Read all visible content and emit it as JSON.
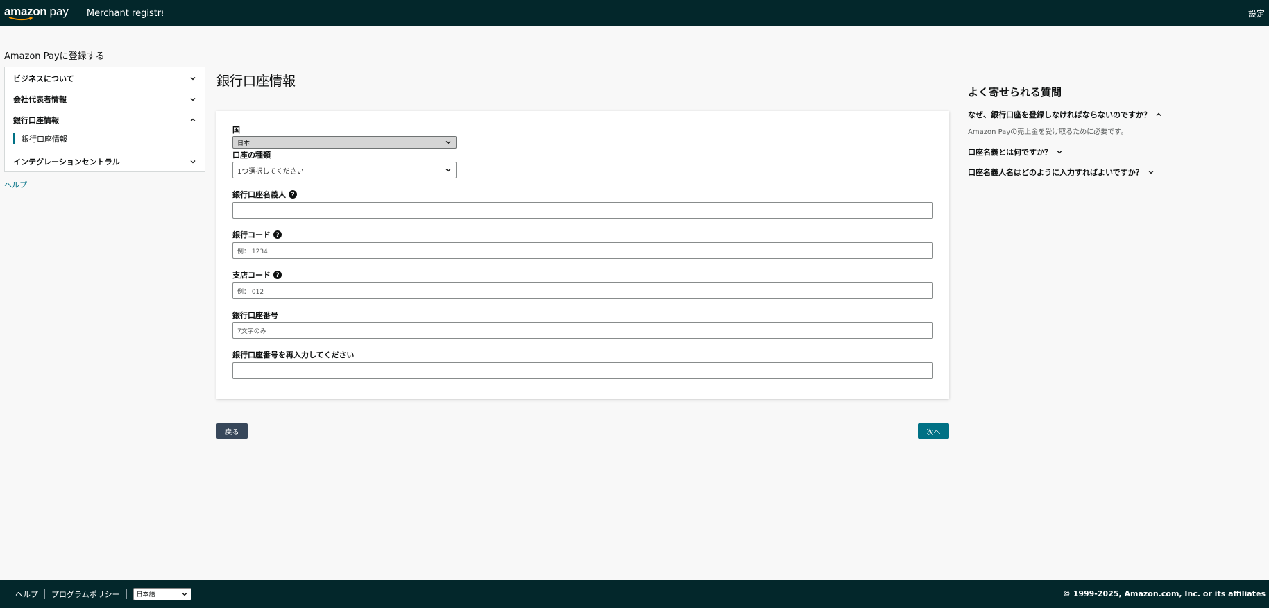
{
  "header": {
    "logo_text": "amazon",
    "logo_pay": "pay",
    "merchant_title": "Merchant registration",
    "settings_label": "設定"
  },
  "sidebar": {
    "register_title": "Amazon Payに登録する",
    "items": [
      {
        "label": "ビジネスについて",
        "expanded": false
      },
      {
        "label": "会社代表者情報",
        "expanded": false
      },
      {
        "label": "銀行口座情報",
        "expanded": true
      },
      {
        "label": "インテグレーションセントラル",
        "expanded": false
      }
    ],
    "sub_item": "銀行口座情報",
    "help_link": "ヘルプ"
  },
  "main": {
    "page_title": "銀行口座情報",
    "fields": {
      "country": {
        "label": "国",
        "value": "日本"
      },
      "account_type": {
        "label": "口座の種類",
        "value": "1つ選択してください"
      },
      "account_holder": {
        "label": "銀行口座名義人",
        "placeholder": ""
      },
      "bank_code": {
        "label": "銀行コード",
        "placeholder": "例： 1234"
      },
      "branch_code": {
        "label": "支店コード",
        "placeholder": "例： 012"
      },
      "account_number": {
        "label": "銀行口座番号",
        "placeholder": "7文字のみ"
      },
      "account_number_confirm": {
        "label": "銀行口座番号を再入力してください",
        "placeholder": ""
      }
    },
    "back_label": "戻る",
    "next_label": "次へ"
  },
  "faq": {
    "title": "よく寄せられる質問",
    "items": [
      {
        "question": "なぜ、銀行口座を登録しなければならないのですか？",
        "answer": "Amazon Payの売上金を受け取るために必要です。",
        "expanded": true
      },
      {
        "question": "口座名義とは何ですか？",
        "expanded": false
      },
      {
        "question": "口座名義人名はどのように入力すればよいですか？",
        "expanded": false
      }
    ]
  },
  "footer": {
    "help_label": "ヘルプ",
    "policy_label": "プログラムポリシー",
    "language_value": "日本語",
    "copyright": "© 1999-2025, Amazon.com, Inc. or its affiliates"
  },
  "colors": {
    "header_bg": "#03272b",
    "accent": "#007185",
    "back_button": "#37475a",
    "smile": "#ff9900"
  },
  "icons": {
    "chevron_down": "chevron-down-icon",
    "chevron_up": "chevron-up-icon",
    "help_circle": "help-circle-icon"
  }
}
